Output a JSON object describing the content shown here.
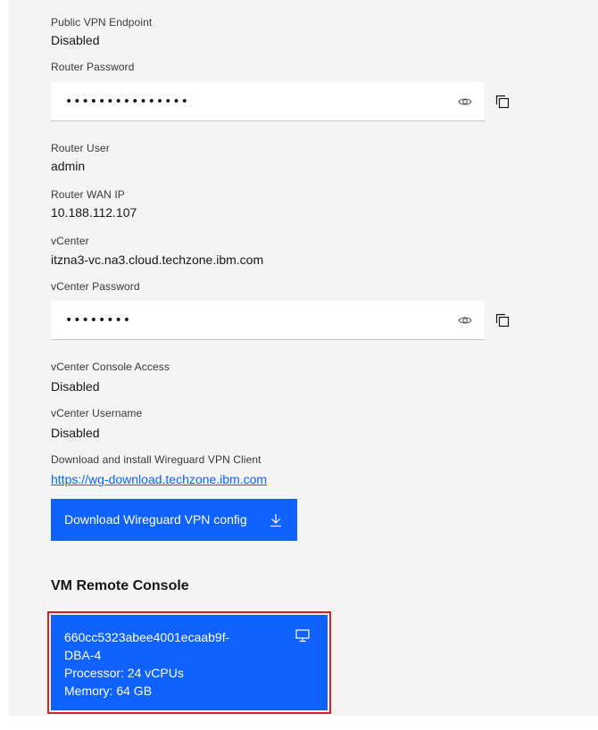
{
  "fields": {
    "public_vpn": {
      "label": "Public VPN Endpoint",
      "value": "Disabled"
    },
    "router_password": {
      "label": "Router Password",
      "masked": "•••••••••••••••"
    },
    "router_user": {
      "label": "Router User",
      "value": "admin"
    },
    "router_wan_ip": {
      "label": "Router WAN IP",
      "value": "10.188.112.107"
    },
    "vcenter": {
      "label": "vCenter",
      "value": "itzna3-vc.na3.cloud.techzone.ibm.com"
    },
    "vcenter_password": {
      "label": "vCenter Password",
      "masked": "••••••••"
    },
    "vcenter_console": {
      "label": "vCenter Console Access",
      "value": "Disabled"
    },
    "vcenter_username": {
      "label": "vCenter Username",
      "value": "Disabled"
    },
    "wireguard": {
      "label": "Download and install Wireguard VPN Client",
      "link": "https://wg-download.techzone.ibm.com"
    }
  },
  "download_button": {
    "label": "Download Wireguard VPN config",
    "icon": "download-icon"
  },
  "vm_console": {
    "heading": "VM Remote Console",
    "tile": {
      "id_line1": "660cc5323abee4001ecaab9f-",
      "id_line2": "DBA-4",
      "processor": "Processor: 24 vCPUs",
      "memory": "Memory: 64 GB",
      "icon": "monitor-icon"
    }
  },
  "colors": {
    "accent": "#0f62fe",
    "panel": "#f4f4f4",
    "highlight": "#da1e28"
  }
}
